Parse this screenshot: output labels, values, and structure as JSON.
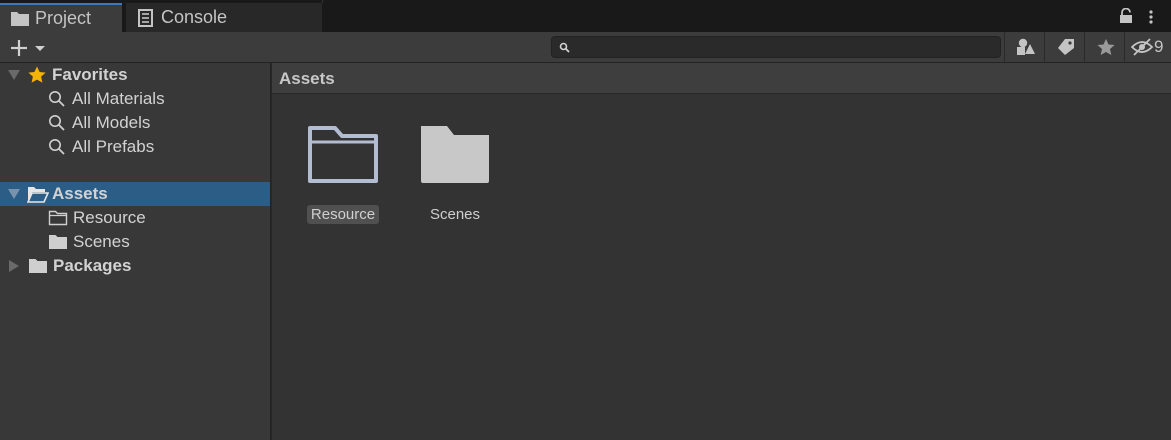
{
  "tabs": [
    {
      "label": "Project",
      "icon": "folder-icon",
      "active": true
    },
    {
      "label": "Console",
      "icon": "console-icon",
      "active": false
    }
  ],
  "toolbar": {
    "search_value": "",
    "hidden_count": "9"
  },
  "sidebar": {
    "favorites": {
      "label": "Favorites",
      "items": [
        {
          "label": "All Materials"
        },
        {
          "label": "All Models"
        },
        {
          "label": "All Prefabs"
        }
      ]
    },
    "assets": {
      "label": "Assets",
      "selected": true,
      "children": [
        {
          "label": "Resource"
        },
        {
          "label": "Scenes"
        }
      ]
    },
    "packages": {
      "label": "Packages"
    }
  },
  "main": {
    "breadcrumb": "Assets",
    "items": [
      {
        "label": "Resource",
        "selected": true,
        "icon": "folder-outline-icon"
      },
      {
        "label": "Scenes",
        "selected": false,
        "icon": "folder-icon"
      }
    ]
  },
  "colors": {
    "selection": "#2c5d87",
    "accent": "#3a79bb",
    "star": "#f4b400",
    "folder_selected": "#b3bdd1",
    "folder": "#c8c8c8"
  }
}
